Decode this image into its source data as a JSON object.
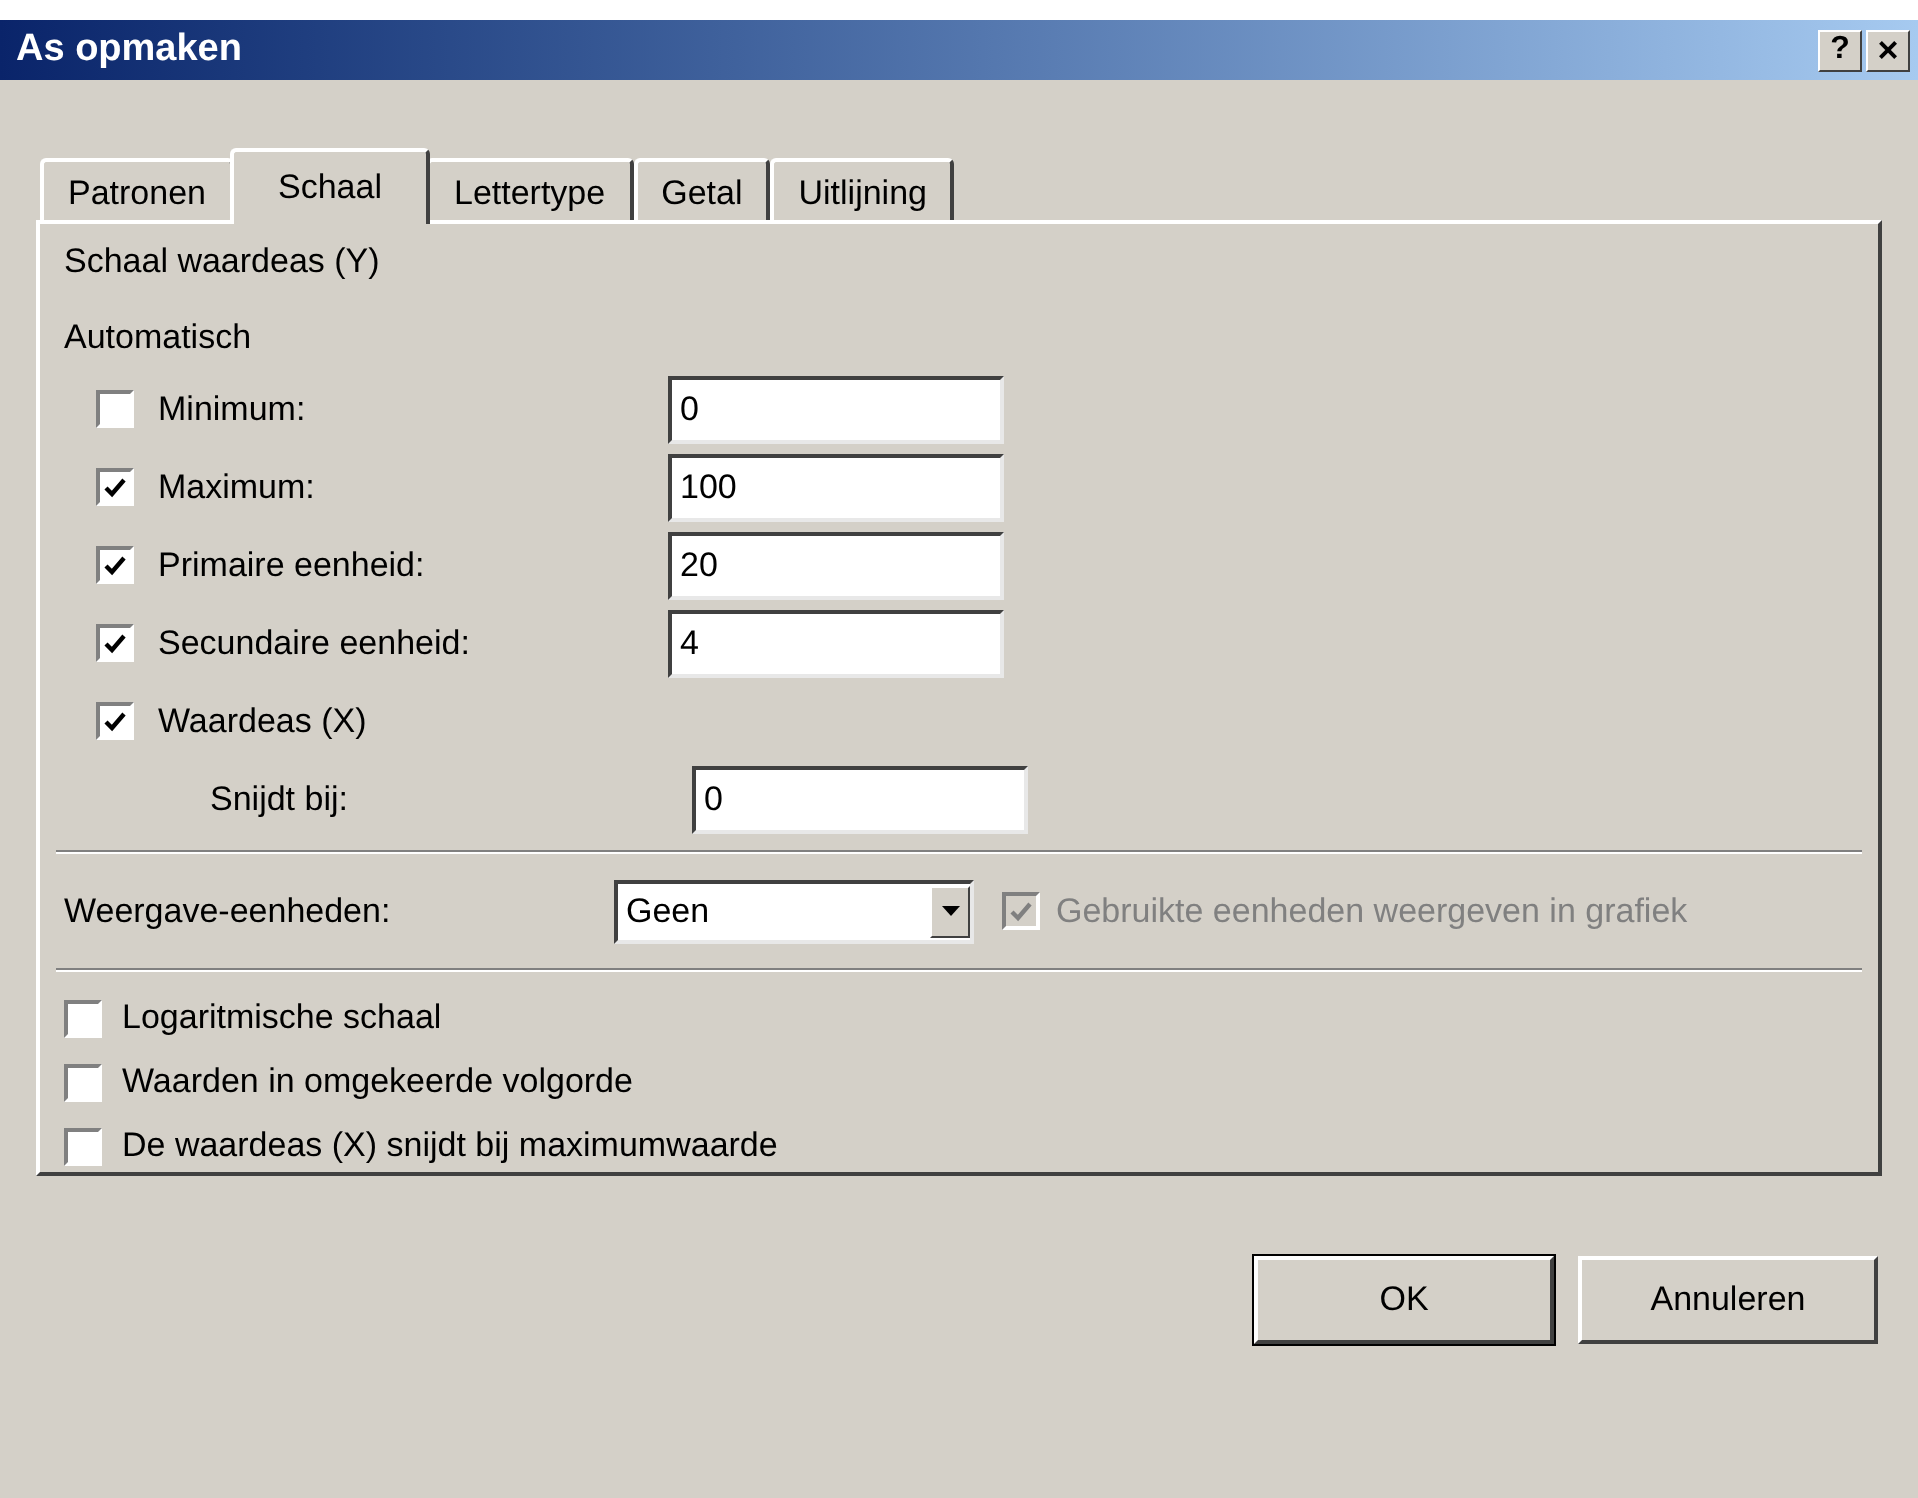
{
  "window": {
    "title": "As opmaken",
    "help_button": "?",
    "close_button": "×"
  },
  "tabs": [
    {
      "label": "Patronen",
      "selected": false
    },
    {
      "label": "Schaal",
      "selected": true
    },
    {
      "label": "Lettertype",
      "selected": false
    },
    {
      "label": "Getal",
      "selected": false
    },
    {
      "label": "Uitlijning",
      "selected": false
    }
  ],
  "section_title": "Schaal waardeas (Y)",
  "group_label": "Automatisch",
  "rows": [
    {
      "kind": "check_field",
      "label": "Minimum:",
      "checked": false,
      "value": "0"
    },
    {
      "kind": "check_field",
      "label": "Maximum:",
      "checked": true,
      "value": "100"
    },
    {
      "kind": "check_field",
      "label": "Primaire eenheid:",
      "checked": true,
      "value": "20"
    },
    {
      "kind": "check_field",
      "label": "Secundaire eenheid:",
      "checked": true,
      "value": "4"
    },
    {
      "kind": "check",
      "label": "Waardeas (X)",
      "checked": true
    },
    {
      "kind": "field",
      "label": "Snijdt bij:",
      "value": "0"
    }
  ],
  "display_units": {
    "label": "Weergave-eenheden:",
    "value": "Geen",
    "show_label": {
      "label": "Gebruikte eenheden weergeven in grafiek",
      "checked": true,
      "disabled": true
    }
  },
  "options": [
    {
      "label": "Logaritmische schaal",
      "checked": false
    },
    {
      "label": "Waarden in omgekeerde volgorde",
      "checked": false
    },
    {
      "label": "De waardeas (X) snijdt bij maximumwaarde",
      "checked": false
    }
  ],
  "buttons": [
    {
      "label": "OK",
      "default": true
    },
    {
      "label": "Annuleren",
      "default": false
    }
  ]
}
